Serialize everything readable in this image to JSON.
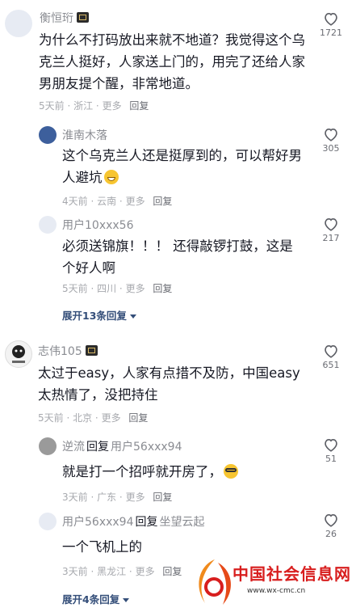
{
  "comments": [
    {
      "user": "衡恒珩",
      "text": "为什么不打码放出来就不地道？我觉得这个乌克兰人挺好，人家送上门的，用完了还给人家男朋友提个醒，非常地道。",
      "time": "5天前",
      "location": "浙江",
      "more": "更多",
      "reply": "回复",
      "likes": "1721",
      "replies": [
        {
          "user": "淮南木落",
          "text": "这个乌克兰人还是挺厚到的，可以帮好男人避坑",
          "time": "4天前",
          "location": "云南",
          "more": "更多",
          "reply": "回复",
          "likes": "305"
        },
        {
          "user": "用户10xxx56",
          "text": "必须送锦旗！！！ 还得敲锣打鼓，这是个好人啊",
          "time": "5天前",
          "location": "四川",
          "more": "更多",
          "reply": "回复",
          "likes": "217"
        }
      ],
      "expand": "展开13条回复"
    },
    {
      "user": "志伟105",
      "text": "太过于easy，人家有点措不及防，中国easy太热情了，没把持住",
      "time": "5天前",
      "location": "北京",
      "more": "更多",
      "reply": "回复",
      "likes": "651",
      "replies": [
        {
          "user": "逆流",
          "reply_word": "回复",
          "target": "用户56xxx94",
          "text": "就是打一个招呼就开房了，",
          "time": "3天前",
          "location": "广东",
          "more": "更多",
          "reply": "回复",
          "likes": "51"
        },
        {
          "user": "用户56xxx94",
          "reply_word": "回复",
          "target": "坐望云起",
          "text": "一个飞机上的",
          "time": "3天前",
          "location": "黑龙江",
          "more": "更多",
          "reply": "回复",
          "likes": "26"
        }
      ],
      "expand": "展开4条回复"
    }
  ],
  "watermark": {
    "title": "中国社会信息网",
    "url": "www.wx-cmc.cn"
  },
  "icons": {
    "like": "heart-outline-icon",
    "expand": "triangle-down-icon",
    "badge": "user-badge-icon",
    "emoji_1": "grinning-emoji",
    "emoji_2": "glasses-emoji"
  },
  "colors": {
    "username": "#8a8c92",
    "text": "#161823",
    "meta": "#a7a9ae",
    "expand": "#344e79",
    "watermark": "#d81e1e"
  }
}
